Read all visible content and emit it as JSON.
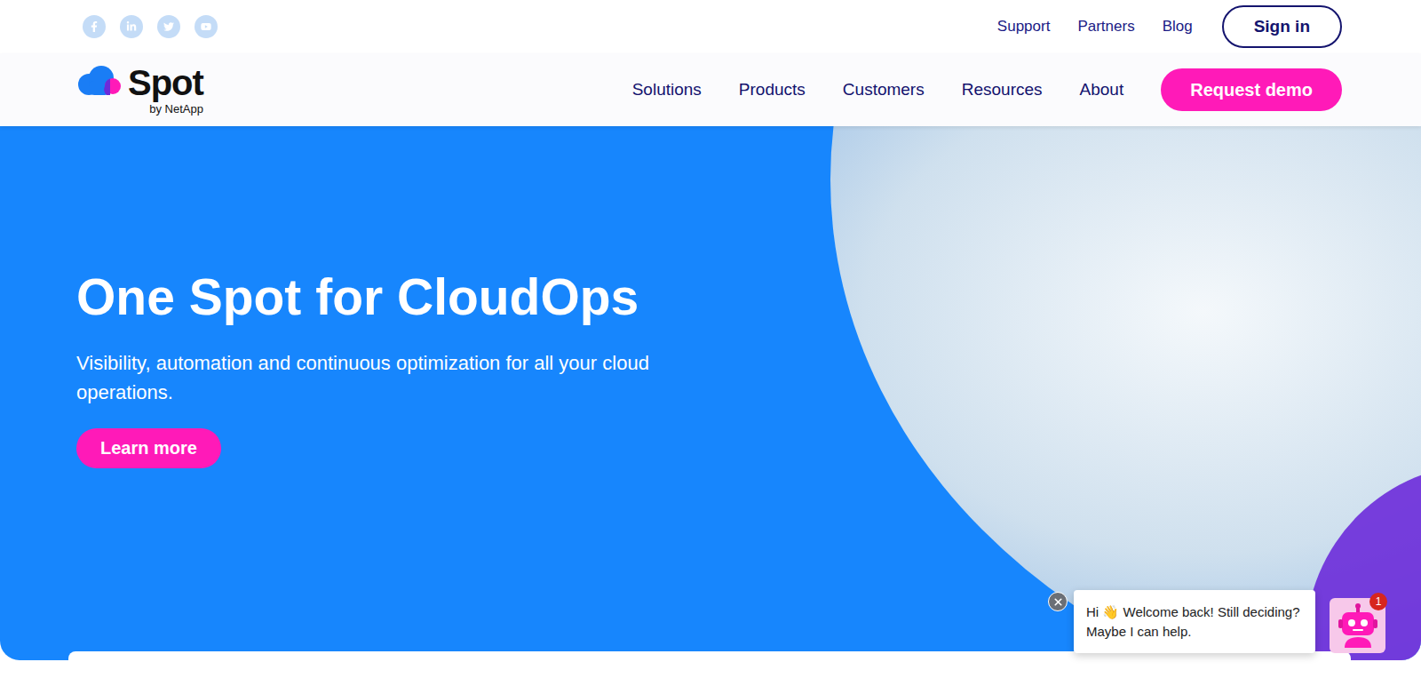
{
  "topbar": {
    "links": [
      "Support",
      "Partners",
      "Blog"
    ],
    "signIn": "Sign in"
  },
  "logo": {
    "name": "Spot",
    "sub": "by NetApp"
  },
  "nav": {
    "items": [
      "Solutions",
      "Products",
      "Customers",
      "Resources",
      "About"
    ],
    "cta": "Request demo"
  },
  "hero": {
    "title": "One Spot for CloudOps",
    "subtitle": "Visibility, automation and continuous optimization for all your cloud operations.",
    "button": "Learn more"
  },
  "chat": {
    "message": "Hi 👋 Welcome back! Still deciding? Maybe I can help.",
    "badge": "1"
  }
}
